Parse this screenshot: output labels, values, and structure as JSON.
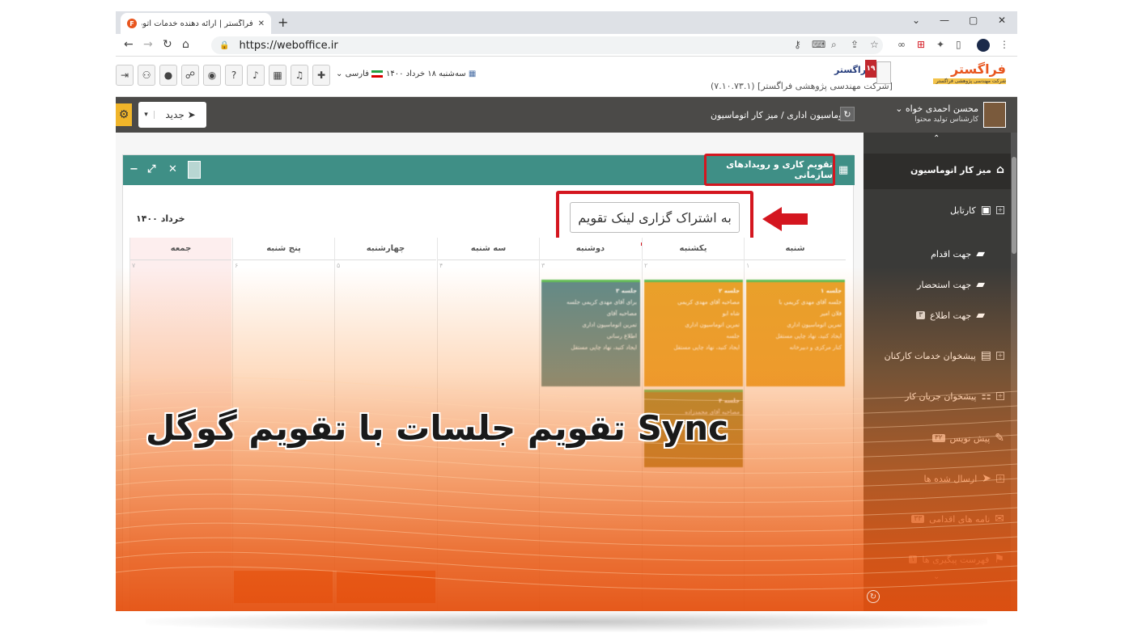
{
  "browser": {
    "tab_title": "فراگستر | ارائه دهنده خدمات اتوماسیون اداری",
    "tab_favicon": "F",
    "tab_close": "✕",
    "new_tab": "+",
    "url": "https://weboffice.ir",
    "win_min": "—",
    "win_max": "▢",
    "win_close": "✕",
    "chevron": "⌄"
  },
  "header": {
    "brand_name": "فراگستر",
    "brand_sub": "[شرکت مهندسی پژوهشی فراگستر] (۷.۱۰.۷۳.۱)",
    "badge": "۱۹",
    "date": "سه‌شنبه ۱۸ خرداد ۱۴۰۰",
    "language": "فارسی",
    "logo_text": "فراگستر",
    "logo_sub": "شرکت مهندسی پژوهشی فراگستر"
  },
  "toolbar": {
    "new_label": "جدید",
    "breadcrumb": "اتوماسیون اداری /  میز کار اتوماسیون",
    "user_name": "محسن احمدی خواه",
    "user_role": "کارشناس تولید محتوا"
  },
  "panel": {
    "title": "تقویم کاری و رویدادهای سازمانی",
    "share_button": "به اشتراک گزاری لینک تقویم",
    "month": "خرداد ۱۴۰۰",
    "days": [
      "شنبه",
      "یکشنبه",
      "دوشنبه",
      "سه شنبه",
      "چهارشنبه",
      "پنج شنبه",
      "جمعه"
    ],
    "day_numbers": [
      "۱",
      "۲",
      "۳",
      "۴",
      "۵",
      "۶",
      "۷"
    ]
  },
  "events": [
    {
      "title": "جلسه ۱",
      "lines": [
        "جلسه آقای مهدی کریمی با",
        "فلان امیر",
        "تمرین اتوماسیون اداری",
        "ایجاد کنید، نهاد چاپی مستقل",
        "کنار مرکزی و دبیرخانه"
      ]
    },
    {
      "title": "جلسه ۲",
      "lines": [
        "مصاحبه آقای مهدی کریمی",
        "شاه ابو",
        "تمرین اتوماسیون اداری",
        "جلسه",
        "ایجاد کنید، نهاد چاپی مستقل"
      ]
    },
    {
      "title": "جلسه ۳",
      "lines": [
        "برای آقای مهدی کریمی جلسه",
        "مصاحبه آقای",
        "تمرین اتوماسیون اداری",
        "اطلاع رسانی",
        "ایجاد کنید، نهاد چاپی مستقل"
      ]
    },
    {
      "title": "جلسه ۴",
      "lines": [
        "مصاحبه آقای محمدزاده"
      ]
    }
  ],
  "sidebar": {
    "items": [
      {
        "label": "میز کار اتوماسیون"
      },
      {
        "label": "کارتابل"
      },
      {
        "label": "جهت اقدام"
      },
      {
        "label": "جهت استحضار"
      },
      {
        "label": "جهت اطلاع",
        "count": "۳"
      },
      {
        "label": "پیشخوان خدمات کارکنان"
      },
      {
        "label": "پیشخوان جریان کار"
      },
      {
        "label": "پیش نویس",
        "count": "۳۲"
      },
      {
        "label": "ارسال شده ها"
      },
      {
        "label": "نامه های اقدامی",
        "count": "۳۳"
      },
      {
        "label": "فهرست پیگیری ها",
        "count": "۱"
      }
    ]
  },
  "overlay": {
    "headline": "Sync تقویم جلسات با تقویم گوگل"
  }
}
